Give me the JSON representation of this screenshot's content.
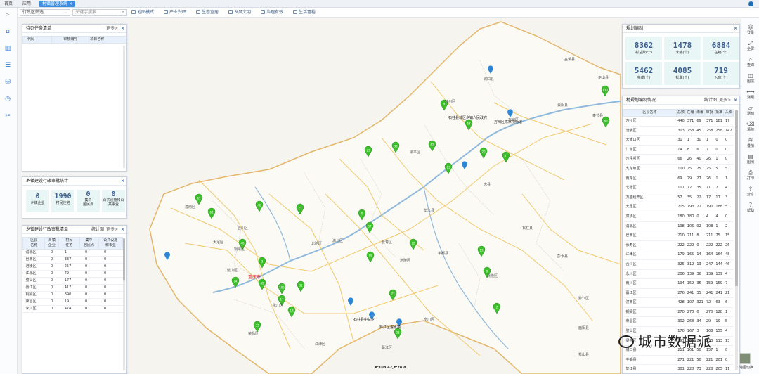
{
  "topbar": {
    "tabs": [
      "首页",
      "应用",
      "村镇管理系统"
    ],
    "tab_close": "×"
  },
  "toolbar": {
    "region_select": "行政区筛选",
    "search_placeholder": "关键字搜索",
    "buttons": [
      "地图模式",
      "产业兴旺",
      "生态宜居",
      "乡风文明",
      "治理有效",
      "生活富裕"
    ]
  },
  "leftnav": {
    "toggle": ">",
    "icons": [
      "home-icon",
      "chart-icon",
      "list-icon",
      "database-icon",
      "clock-icon",
      "tools-icon"
    ]
  },
  "panel_pending": {
    "title": "待办任务清单",
    "more": "更多>",
    "close": "×",
    "columns": [
      "代码",
      "审核编号",
      "项目名称"
    ]
  },
  "panel_approval": {
    "title": "乡镇建设行政审批统计",
    "close": "×",
    "stats": [
      {
        "value": "0",
        "label": "乡镇企业"
      },
      {
        "value": "1990",
        "label": "村民住宅"
      },
      {
        "value": "0",
        "label": "集中\n居民点"
      },
      {
        "value": "0",
        "label": "公共设施和公\n共事业"
      }
    ]
  },
  "panel_district": {
    "title": "乡镇建设行政审批清单",
    "stat_link": "统计图",
    "more": "更多>",
    "close": "×",
    "columns": [
      "区县\n名称",
      "乡镇\n企业",
      "村民\n住宅",
      "集中\n居民点",
      "公共设施\n和事业"
    ],
    "rows": [
      [
        "渝北区",
        "0",
        "1",
        "0",
        "0"
      ],
      [
        "巴南区",
        "0",
        "337",
        "0",
        "0"
      ],
      [
        "涪陵区",
        "0",
        "257",
        "0",
        "0"
      ],
      [
        "江北区",
        "0",
        "79",
        "0",
        "0"
      ],
      [
        "璧山区",
        "0",
        "177",
        "0",
        "0"
      ],
      [
        "綦江区",
        "0",
        "417",
        "0",
        "0"
      ],
      [
        "铜梁区",
        "0",
        "390",
        "0",
        "0"
      ],
      [
        "荣昌区",
        "0",
        "19",
        "0",
        "0"
      ],
      [
        "永川区",
        "0",
        "474",
        "0",
        "0"
      ]
    ]
  },
  "panel_plan": {
    "title": "规划编制",
    "close": "×",
    "stats": [
      {
        "value": "8362",
        "label": "村总数(个)"
      },
      {
        "value": "1478",
        "label": "未编(个)"
      },
      {
        "value": "6884",
        "label": "在编(个)"
      },
      {
        "value": "5462",
        "label": "完成(个)"
      },
      {
        "value": "4085",
        "label": "批准(个)"
      },
      {
        "value": "719",
        "label": "入库(个)"
      }
    ]
  },
  "panel_village": {
    "title": "村规划编制情况",
    "stat_link": "统计图",
    "more": "更多>",
    "close": "×",
    "columns": [
      "区县名称",
      "总数",
      "在编",
      "未编",
      "审批",
      "批准",
      "入库"
    ],
    "rows": [
      [
        "万州区",
        "440",
        "371",
        "69",
        "371",
        "181",
        "17"
      ],
      [
        "涪陵区",
        "303",
        "258",
        "45",
        "258",
        "258",
        "142"
      ],
      [
        "大渡口区",
        "31",
        "1",
        "30",
        "1",
        "0",
        "0"
      ],
      [
        "江北区",
        "14",
        "8",
        "6",
        "7",
        "0",
        "0"
      ],
      [
        "沙坪坝区",
        "66",
        "26",
        "40",
        "26",
        "1",
        "0"
      ],
      [
        "九龙坡区",
        "100",
        "25",
        "25",
        "25",
        "5",
        "5"
      ],
      [
        "南岸区",
        "69",
        "29",
        "27",
        "26",
        "1",
        "1"
      ],
      [
        "北碚区",
        "107",
        "72",
        "35",
        "71",
        "7",
        "4"
      ],
      [
        "万盛经开区",
        "57",
        "35",
        "22",
        "17",
        "17",
        "3"
      ],
      [
        "大足区",
        "215",
        "193",
        "22",
        "190",
        "188",
        "5"
      ],
      [
        "双桥区",
        "180",
        "180",
        "0",
        "4",
        "4",
        "0"
      ],
      [
        "渝北区",
        "198",
        "106",
        "92",
        "108",
        "1",
        "2"
      ],
      [
        "巴南区",
        "210",
        "211",
        "8",
        "211",
        "75",
        "15"
      ],
      [
        "长寿区",
        "222",
        "222",
        "0",
        "222",
        "222",
        "26"
      ],
      [
        "江津区",
        "179",
        "165",
        "14",
        "164",
        "164",
        "48"
      ],
      [
        "合川区",
        "325",
        "312",
        "13",
        "247",
        "144",
        "46"
      ],
      [
        "永川区",
        "206",
        "139",
        "36",
        "139",
        "139",
        "4"
      ],
      [
        "南川区",
        "194",
        "159",
        "35",
        "159",
        "159",
        "7"
      ],
      [
        "綦江区",
        "276",
        "241",
        "35",
        "241",
        "241",
        "21"
      ],
      [
        "潼南区",
        "428",
        "107",
        "321",
        "72",
        "63",
        "6"
      ],
      [
        "铜梁区",
        "270",
        "270",
        "0",
        "270",
        "128",
        "1"
      ],
      [
        "荣昌区",
        "302",
        "268",
        "34",
        "29",
        "19",
        "5"
      ],
      [
        "璧山区",
        "170",
        "167",
        "3",
        "168",
        "155",
        "4"
      ],
      [
        "梁平区",
        "291",
        "265",
        "26",
        "233",
        "113",
        "13"
      ],
      [
        "城口县",
        "211",
        "161",
        "50",
        "157",
        "1",
        "0"
      ],
      [
        "丰都县",
        "271",
        "221",
        "50",
        "221",
        "201",
        "0"
      ],
      [
        "垫江县",
        "301",
        "228",
        "73",
        "228",
        "205",
        "11"
      ]
    ]
  },
  "rightbar": {
    "items": [
      {
        "icon": "user-icon",
        "label": "登录"
      },
      {
        "icon": "fullscreen-icon",
        "label": "全屏"
      },
      {
        "icon": "search-icon",
        "label": "查询"
      },
      {
        "icon": "layers-icon",
        "label": "图层"
      },
      {
        "icon": "measure-icon",
        "label": "测距"
      },
      {
        "icon": "area-icon",
        "label": "测面"
      },
      {
        "icon": "clear-icon",
        "label": "清除"
      },
      {
        "icon": "stack-icon",
        "label": "叠加"
      },
      {
        "icon": "legend-icon",
        "label": "图例"
      },
      {
        "icon": "print-icon",
        "label": "打印"
      },
      {
        "icon": "share-icon",
        "label": "分享"
      },
      {
        "icon": "help-icon",
        "label": "帮助"
      }
    ]
  },
  "map": {
    "markers": [
      {
        "label": "9",
        "color": "green"
      },
      {
        "label": "57",
        "color": "green"
      },
      {
        "label": "23",
        "color": "green"
      },
      {
        "label": "38",
        "color": "green"
      },
      {
        "label": "82",
        "color": "green"
      },
      {
        "label": "130",
        "color": "green"
      },
      {
        "label": "60",
        "color": "green"
      },
      {
        "label": "20",
        "color": "green"
      },
      {
        "label": "31",
        "color": "green"
      },
      {
        "label": "63",
        "color": "green"
      },
      {
        "label": "19",
        "color": "green"
      },
      {
        "label": "61",
        "color": "green"
      },
      {
        "label": "62",
        "color": "green"
      },
      {
        "label": "48",
        "color": "green"
      },
      {
        "label": "40",
        "color": "green"
      },
      {
        "label": "0",
        "color": "green"
      },
      {
        "label": "37",
        "color": "green"
      },
      {
        "label": "27",
        "color": "green"
      },
      {
        "label": "3",
        "color": "green"
      },
      {
        "label": "17",
        "color": "green"
      },
      {
        "label": "22",
        "color": "green"
      },
      {
        "label": "13",
        "color": "green"
      },
      {
        "label": "9",
        "color": "green"
      },
      {
        "label": "31",
        "color": "green"
      },
      {
        "label": "14",
        "color": "green"
      },
      {
        "label": "45",
        "color": "green"
      },
      {
        "label": "2",
        "color": "green"
      },
      {
        "label": "105",
        "color": "green"
      },
      {
        "label": "23",
        "color": "green"
      },
      {
        "label": "18",
        "color": "green"
      },
      {
        "label": "33",
        "color": "green"
      },
      {
        "label": "23",
        "color": "green"
      }
    ],
    "place_labels": [
      "开州区",
      "云阳县",
      "巫山县",
      "巫溪县",
      "城口县",
      "奉节县",
      "万州区",
      "忠县",
      "梁平区",
      "垫江县",
      "长寿区",
      "涪陵区",
      "丰都县",
      "石柱县",
      "武隆区",
      "彭水县",
      "黔江区",
      "酉阳县",
      "秀山县",
      "南川区",
      "綦江区",
      "江津区",
      "永川区",
      "荣昌区",
      "大足区",
      "潼南区",
      "铜梁区",
      "合川区",
      "北碚区",
      "渝北区",
      "璧山区"
    ],
    "poi_labels": [
      "石柱县城区乡镇人民政府",
      "万州区陈家坝街道",
      "石柱县中益乡",
      "黔江区濯水镇"
    ],
    "city_label": "重庆市",
    "coordinate": "X:108.42,Y:28.8"
  },
  "watermark": {
    "text": "城市数据派"
  },
  "minimap": {
    "label": "地图切换"
  }
}
